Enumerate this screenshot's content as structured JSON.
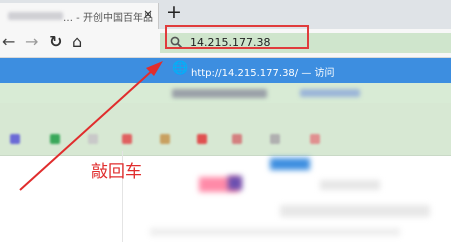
{
  "tab": {
    "title": "… - 开创中国百年品",
    "close": "×"
  },
  "toolbar": {
    "new_tab": "+",
    "back": "←",
    "forward": "→",
    "reload": "↻",
    "home": "⌂"
  },
  "address_bar": {
    "search_icon": "search-icon",
    "value": "14.215.177.38"
  },
  "dropdown": {
    "first_suggestion": "http://14.215.177.38/ — 访问"
  },
  "annotation": {
    "text": "敲回车",
    "color": "#e02d2d"
  },
  "colors": {
    "highlight": "#3d8ee0",
    "address_bar": "#cfe5cc",
    "red_box": "#e03c3c"
  }
}
